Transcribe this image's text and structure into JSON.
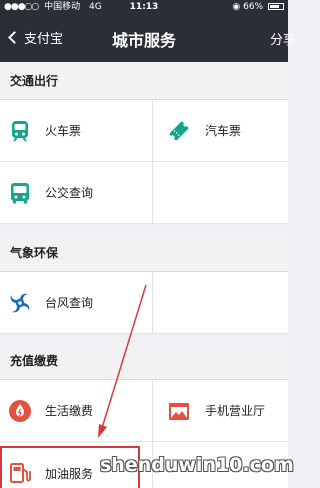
{
  "status_bar": {
    "signal": "●●●○○",
    "carrier": "中国移动",
    "network": "4G",
    "time": "11:13",
    "battery": "66%"
  },
  "nav": {
    "back_label": "支付宝",
    "title": "城市服务",
    "share_label": "分享"
  },
  "sections": [
    {
      "title": "交通出行",
      "items": [
        {
          "label": "火车票",
          "icon": "train-icon"
        },
        {
          "label": "汽车票",
          "icon": "ticket-icon"
        },
        {
          "label": "公交查询",
          "icon": "bus-icon"
        }
      ]
    },
    {
      "title": "气象环保",
      "items": [
        {
          "label": "台风查询",
          "icon": "typhoon-icon"
        }
      ]
    },
    {
      "title": "充值缴费",
      "items": [
        {
          "label": "生活缴费",
          "icon": "water-drop-icon"
        },
        {
          "label": "手机营业厅",
          "icon": "phone-hall-icon"
        },
        {
          "label": "加油服务",
          "icon": "fuel-pump-icon"
        }
      ]
    }
  ],
  "colors": {
    "nav_bg": "#2b2e36",
    "transport_green": "#13a68c",
    "typhoon_blue": "#1b6fb8",
    "payment_red": "#e2523e",
    "highlight_red": "#d7393b"
  },
  "watermark": "shenduwin10.com"
}
